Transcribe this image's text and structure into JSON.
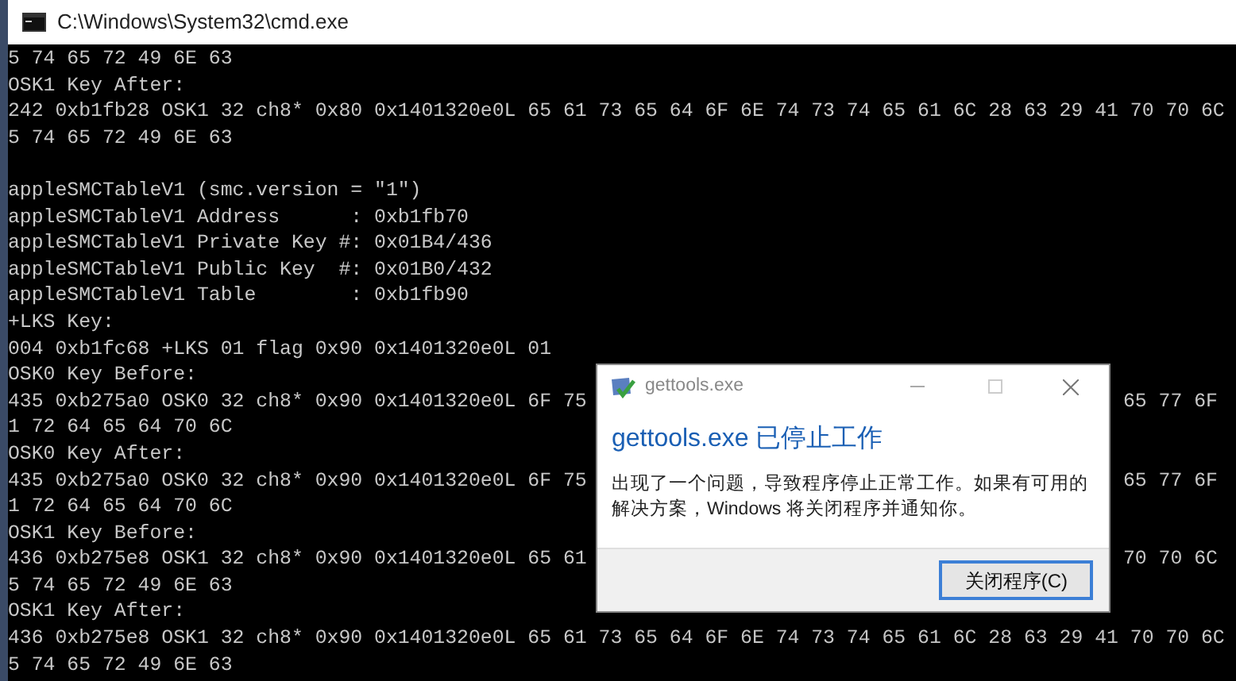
{
  "window": {
    "title": "C:\\Windows\\System32\\cmd.exe"
  },
  "console_lines": [
    {
      "kind": "text",
      "text": "5 74 65 72 49 6E 63"
    },
    {
      "kind": "text",
      "text": "OSK1 Key After:"
    },
    {
      "kind": "text",
      "text": "242 0xb1fb28 OSK1 32 ch8* 0x80 0x1401320e0L 65 61 73 65 64 6F 6E 74 73 74 65 61 6C 28 63 29 41 70 70 6C"
    },
    {
      "kind": "text",
      "text": "5 74 65 72 49 6E 63"
    },
    {
      "kind": "blank"
    },
    {
      "kind": "text",
      "text": "appleSMCTableV1 (smc.version = \"1\")"
    },
    {
      "kind": "text",
      "text": "appleSMCTableV1 Address      : 0xb1fb70"
    },
    {
      "kind": "text",
      "text": "appleSMCTableV1 Private Key #: 0x01B4/436"
    },
    {
      "kind": "text",
      "text": "appleSMCTableV1 Public Key  #: 0x01B0/432"
    },
    {
      "kind": "text",
      "text": "appleSMCTableV1 Table        : 0xb1fb90"
    },
    {
      "kind": "text",
      "text": "+LKS Key:"
    },
    {
      "kind": "text",
      "text": "004 0xb1fc68 +LKS 01 flag 0x90 0x1401320e0L 01"
    },
    {
      "kind": "text",
      "text": "OSK0 Key Before:"
    },
    {
      "kind": "text",
      "text": "435 0xb275a0 OSK0 32 ch8* 0x90 0x1401320e0L 6F 75",
      "right": "65 77 6F"
    },
    {
      "kind": "text",
      "text": "1 72 64 65 64 70 6C"
    },
    {
      "kind": "text",
      "text": "OSK0 Key After:"
    },
    {
      "kind": "text",
      "text": "435 0xb275a0 OSK0 32 ch8* 0x90 0x1401320e0L 6F 75",
      "right": "65 77 6F"
    },
    {
      "kind": "text",
      "text": "1 72 64 65 64 70 6C"
    },
    {
      "kind": "text",
      "text": "OSK1 Key Before:"
    },
    {
      "kind": "text",
      "text": "436 0xb275e8 OSK1 32 ch8* 0x90 0x1401320e0L 65 61",
      "right": "70 70 6C"
    },
    {
      "kind": "text",
      "text": "5 74 65 72 49 6E 63"
    },
    {
      "kind": "text",
      "text": "OSK1 Key After:"
    },
    {
      "kind": "text",
      "text": "436 0xb275e8 OSK1 32 ch8* 0x90 0x1401320e0L 65 61 73 65 64 6F 6E 74 73 74 65 61 6C 28 63 29 41 70 70 6C"
    },
    {
      "kind": "text",
      "text": "5 74 65 72 49 6E 63"
    }
  ],
  "dialog": {
    "title": "gettools.exe",
    "heading": "gettools.exe 已停止工作",
    "message": "出现了一个问题，导致程序停止正常工作。如果有可用的解决方案，Windows 将关闭程序并通知你。",
    "button": "关闭程序(C)"
  }
}
